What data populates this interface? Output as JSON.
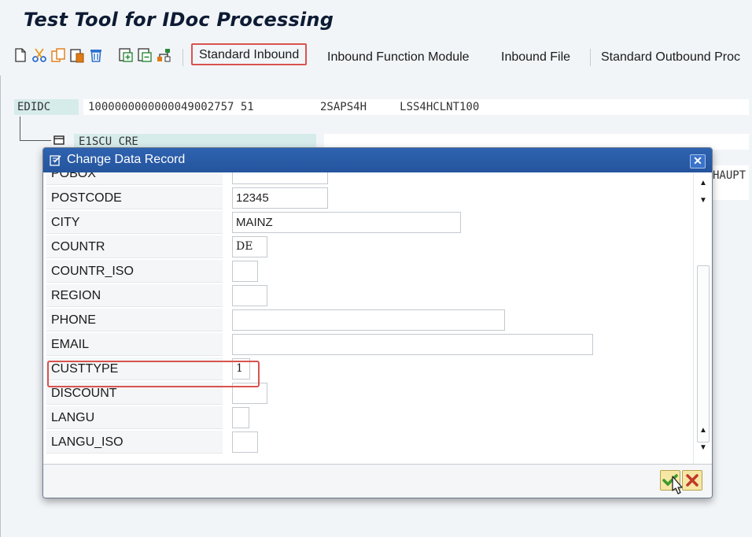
{
  "app": {
    "title": "Test Tool for IDoc Processing"
  },
  "toolbar": {
    "icons": [
      "new-document-icon",
      "cut-icon",
      "copy-icon",
      "paste-icon",
      "delete-icon",
      "expand-icon",
      "collapse-icon",
      "org-structure-icon"
    ],
    "buttons": {
      "standard_inbound": "Standard Inbound",
      "inbound_function_module": "Inbound Function Module",
      "inbound_file": "Inbound File",
      "standard_outbound": "Standard Outbound Proc"
    }
  },
  "tree": {
    "control_record": {
      "label": "EDIDC",
      "value": "1000000000000049002757 51          2SAPS4H     LSS4HCLNT100"
    },
    "segment": {
      "label": "E1SCU_CRE"
    },
    "background_value": "HAUPT"
  },
  "dialog": {
    "title": "Change Data Record",
    "fields": [
      {
        "name": "POBOX",
        "value": ""
      },
      {
        "name": "POSTCODE",
        "value": "12345"
      },
      {
        "name": "CITY",
        "value": "MAINZ"
      },
      {
        "name": "COUNTR",
        "value": "DE"
      },
      {
        "name": "COUNTR_ISO",
        "value": ""
      },
      {
        "name": "REGION",
        "value": ""
      },
      {
        "name": "PHONE",
        "value": ""
      },
      {
        "name": "EMAIL",
        "value": ""
      },
      {
        "name": "CUSTTYPE",
        "value": "1"
      },
      {
        "name": "DISCOUNT",
        "value": ""
      },
      {
        "name": "LANGU",
        "value": ""
      },
      {
        "name": "LANGU_ISO",
        "value": ""
      }
    ],
    "close_glyph": "✕",
    "ok_glyph": "✔",
    "cancel_glyph": "✖"
  },
  "colors": {
    "dialog_header": "#2a5ca8",
    "highlight": "#d9534f",
    "segment_bg": "#d6eceb",
    "ok_check": "#3c9a2c",
    "cancel_x": "#c0392b"
  }
}
